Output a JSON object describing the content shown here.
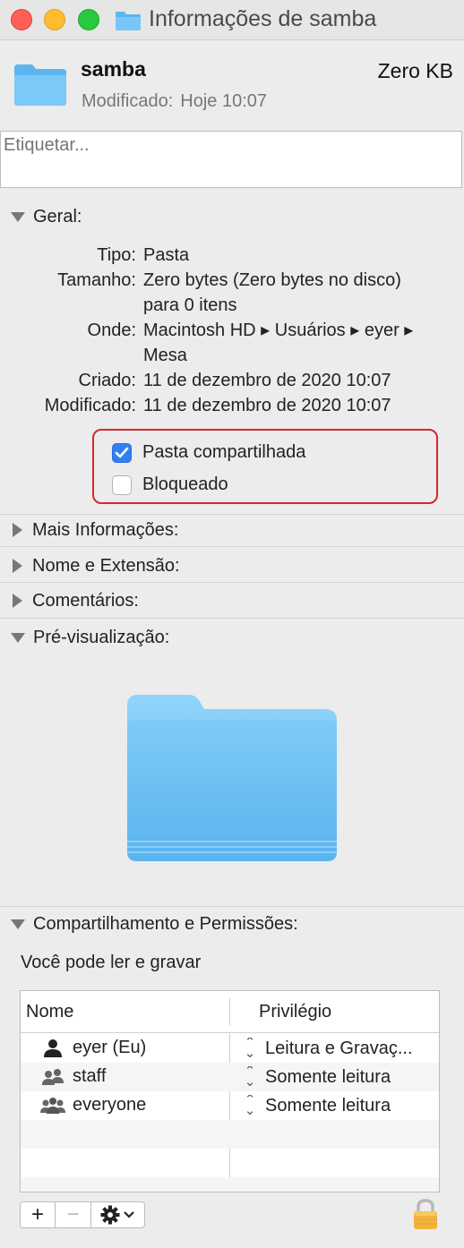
{
  "window": {
    "title": "Informações de samba"
  },
  "header": {
    "name": "samba",
    "size": "Zero KB",
    "modified_label": "Modificado:",
    "modified_value": "Hoje 10:07"
  },
  "tags": {
    "placeholder": "Etiquetar..."
  },
  "general": {
    "title": "Geral:",
    "rows": [
      {
        "key": "Tipo:",
        "value": "Pasta"
      },
      {
        "key": "Tamanho:",
        "value": "Zero bytes (Zero bytes no disco) para 0 itens"
      },
      {
        "key": "Onde:",
        "value": "Macintosh HD ▸ Usuários ▸ eyer ▸ Mesa"
      },
      {
        "key": "Criado:",
        "value": "11 de dezembro de 2020 10:07"
      },
      {
        "key": "Modificado:",
        "value": "11 de dezembro de 2020 10:07"
      }
    ],
    "shared_label": "Pasta compartilhada",
    "shared_checked": true,
    "locked_label": "Bloqueado",
    "locked_checked": false
  },
  "sections": {
    "more_info": "Mais Informações:",
    "name_ext": "Nome e Extensão:",
    "comments": "Comentários:",
    "preview": "Pré-visualização:",
    "sharing": "Compartilhamento e Permissões:"
  },
  "permissions": {
    "caption": "Você pode ler e gravar",
    "col_name": "Nome",
    "col_privilege": "Privilégio",
    "rows": [
      {
        "user": "eyer (Eu)",
        "icon": "single-user-icon",
        "privilege": "Leitura e Gravaç..."
      },
      {
        "user": "staff",
        "icon": "group-icon",
        "privilege": "Somente leitura"
      },
      {
        "user": "everyone",
        "icon": "everyone-icon",
        "privilege": "Somente leitura"
      }
    ]
  },
  "toolbar": {
    "add": "+",
    "remove": "−"
  }
}
